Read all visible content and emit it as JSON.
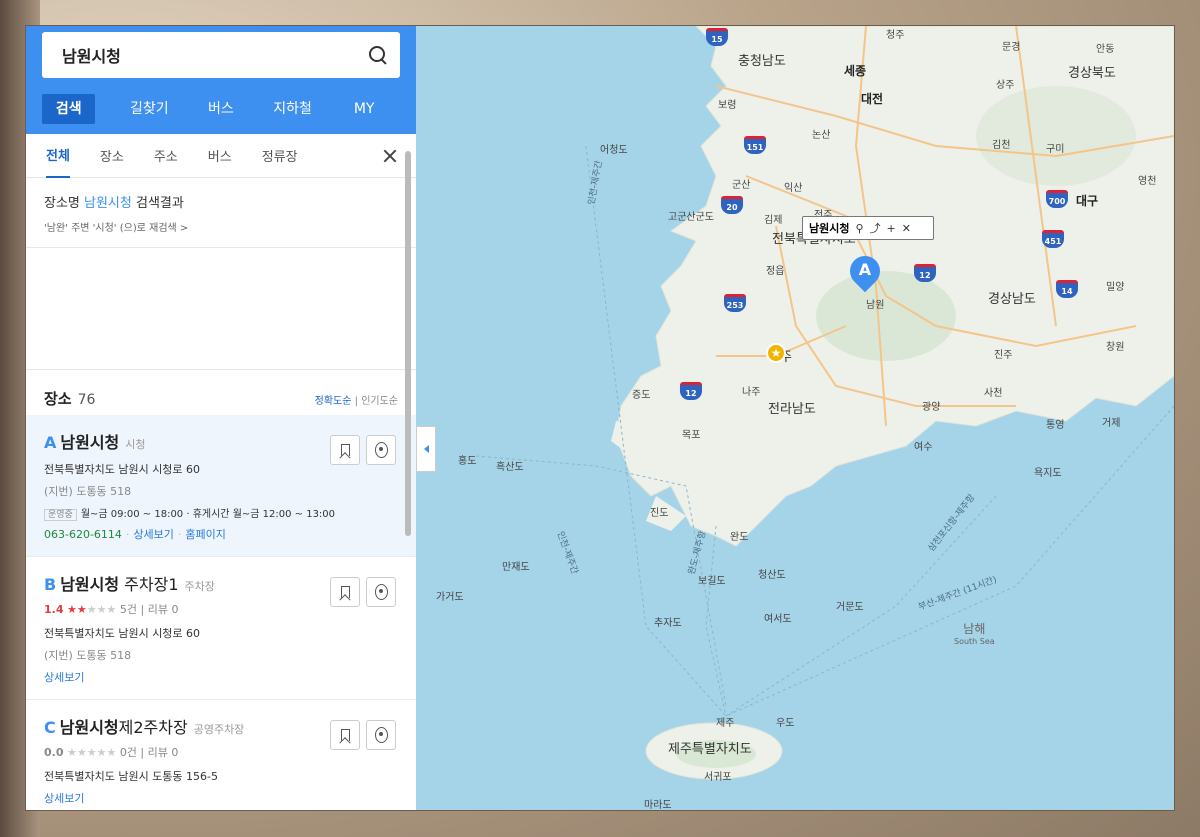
{
  "search": {
    "query": "남원시청"
  },
  "nav": [
    "검색",
    "길찾기",
    "버스",
    "지하철",
    "MY"
  ],
  "tabs": [
    "전체",
    "장소",
    "주소",
    "버스",
    "정류장"
  ],
  "result_info": {
    "prefix": "장소명 ",
    "keyword": "남원시청",
    "suffix": " 검색결과",
    "resuggest": "'남완' 주변 '시청' (으)로 재검색 >"
  },
  "places": {
    "title": "장소",
    "count": "76",
    "sort_accuracy": "정확도순",
    "sort_popular": "인기도순"
  },
  "items": [
    {
      "letter": "A",
      "name": "남원시청",
      "name_rest": "",
      "category": "시청",
      "address": "전북특별자치도 남원시 시청로 60",
      "jibun": "(지번) 도통동 518",
      "hours_tag": "운영중",
      "hours": "월~금 09:00 ~ 18:00 · 휴게시간 월~금 12:00 ~ 13:00",
      "phone": "063-620-6114",
      "link1": "상세보기",
      "link2": "홈페이지"
    },
    {
      "letter": "B",
      "name": "남원시청",
      "name_rest": " 주차장1",
      "category": "주차장",
      "rating": "1.4",
      "stars_on": 1.5,
      "reviews_count": "5건",
      "review_label": "리뷰 0",
      "address": "전북특별자치도 남원시 시청로 60",
      "jibun": "(지번) 도통동 518",
      "link1": "상세보기"
    },
    {
      "letter": "C",
      "name": "남원시청",
      "name_rest": "제2주차장",
      "category": "공영주차장",
      "rating": "0.0",
      "stars_on": 0,
      "reviews_count": "0건",
      "review_label": "리뷰 0",
      "address": "전북특별자치도 남원시 도통동 156-5",
      "link1": "상세보기"
    }
  ],
  "map": {
    "popup_label": "남원시청",
    "marker_letter": "A",
    "labels": {
      "chungnam": "충청남도",
      "sejong": "세종",
      "daejeon": "대전",
      "gyeongbuk": "경상북도",
      "cheongju": "청주",
      "mungyeong": "문경",
      "andong": "안동",
      "sangju": "상주",
      "boryeong": "보령",
      "nonsan": "논산",
      "eocheongdo": "어청도",
      "gimcheon": "김천",
      "gumi": "구미",
      "gunsan": "군산",
      "iksan": "익산",
      "gogunsan": "고군산군도",
      "gimje": "김제",
      "jeonju": "전주",
      "jeonbuk": "전북특별자치도",
      "daegu": "대구",
      "yeongcheon": "영천",
      "jeongeup": "정읍",
      "namwon": "남원",
      "gyeongnam": "경상남도",
      "miryang": "밀양",
      "gwangju": "광주",
      "jinju": "진주",
      "changwon": "창원",
      "naju": "나주",
      "jeonnam": "전라남도",
      "sacheon": "사천",
      "geojedo": "거제",
      "tongyeong": "통영",
      "gwangyang": "광양",
      "yeosu": "여수",
      "yokjido": "욕지도",
      "mokpo": "목포",
      "hongdo": "홍도",
      "heuksando": "흑산도",
      "jindo": "진도",
      "wando": "완도",
      "manjaedo": "만재도",
      "cheongsando": "청산도",
      "bogildo": "보길도",
      "yeoseodo": "여서도",
      "geomundo": "거문도",
      "gageodo": "가거도",
      "chujado": "추자도",
      "jeju_city": "제주",
      "udo": "우도",
      "jeju": "제주특별자치도",
      "seogwipo": "서귀포",
      "marado": "마라도",
      "jeungdo": "증도",
      "namhae": "남해",
      "south_sea": "South Sea",
      "route_incheon_jeju": "인천-제주간",
      "route_incheon_jeju2": "인천-제주간",
      "route_samcheonpo": "삼천포신항-제주항",
      "route_busan_jeju": "부산-제주간 (11시간)",
      "route_wando_jeju": "완도-제주항"
    },
    "shields": [
      "15",
      "151",
      "20",
      "253",
      "12",
      "12",
      "700",
      "451",
      "14"
    ]
  }
}
